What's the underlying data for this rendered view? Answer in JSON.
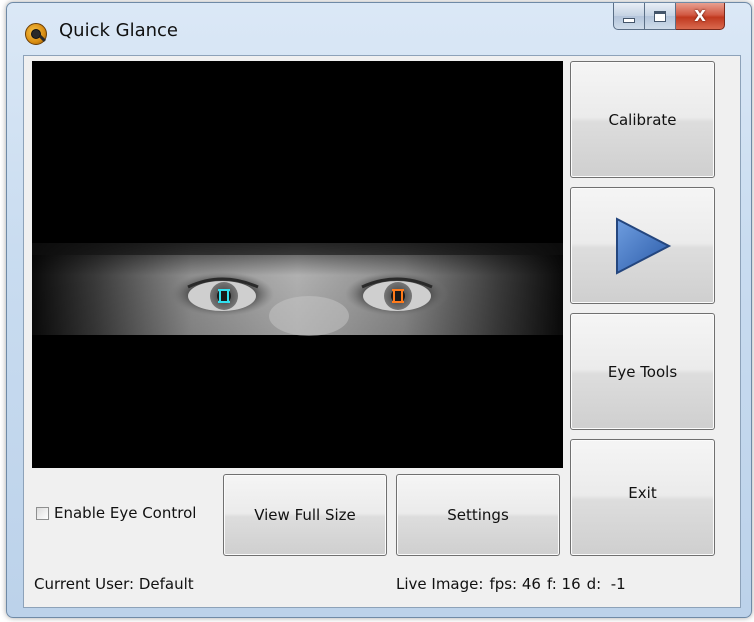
{
  "window": {
    "title": "Quick Glance",
    "app_icon": "quick-glance-logo-icon",
    "caption_buttons": [
      "minimize",
      "maximize",
      "close"
    ],
    "close_glyph": "X"
  },
  "preview": {
    "pupil_left_color": "#31e0f0",
    "pupil_right_color": "#ff7a1a"
  },
  "buttons": {
    "calibrate": "Calibrate",
    "play_icon": "play-triangle-icon",
    "eye_tools": "Eye Tools",
    "exit": "Exit",
    "view_full_size": "View Full Size",
    "settings": "Settings"
  },
  "controls": {
    "enable_eye_control_label": "Enable Eye Control",
    "enable_eye_control_checked": false
  },
  "status": {
    "current_user": "Current User: Default",
    "live_prefix": "Live Image:",
    "fps": "fps: 46",
    "f": "f: 16",
    "d": "d:  -1"
  },
  "colors": {
    "play_triangle": "#3a6fc4",
    "titlebar": "#c9dcf0",
    "close_button": "#c0391f"
  }
}
